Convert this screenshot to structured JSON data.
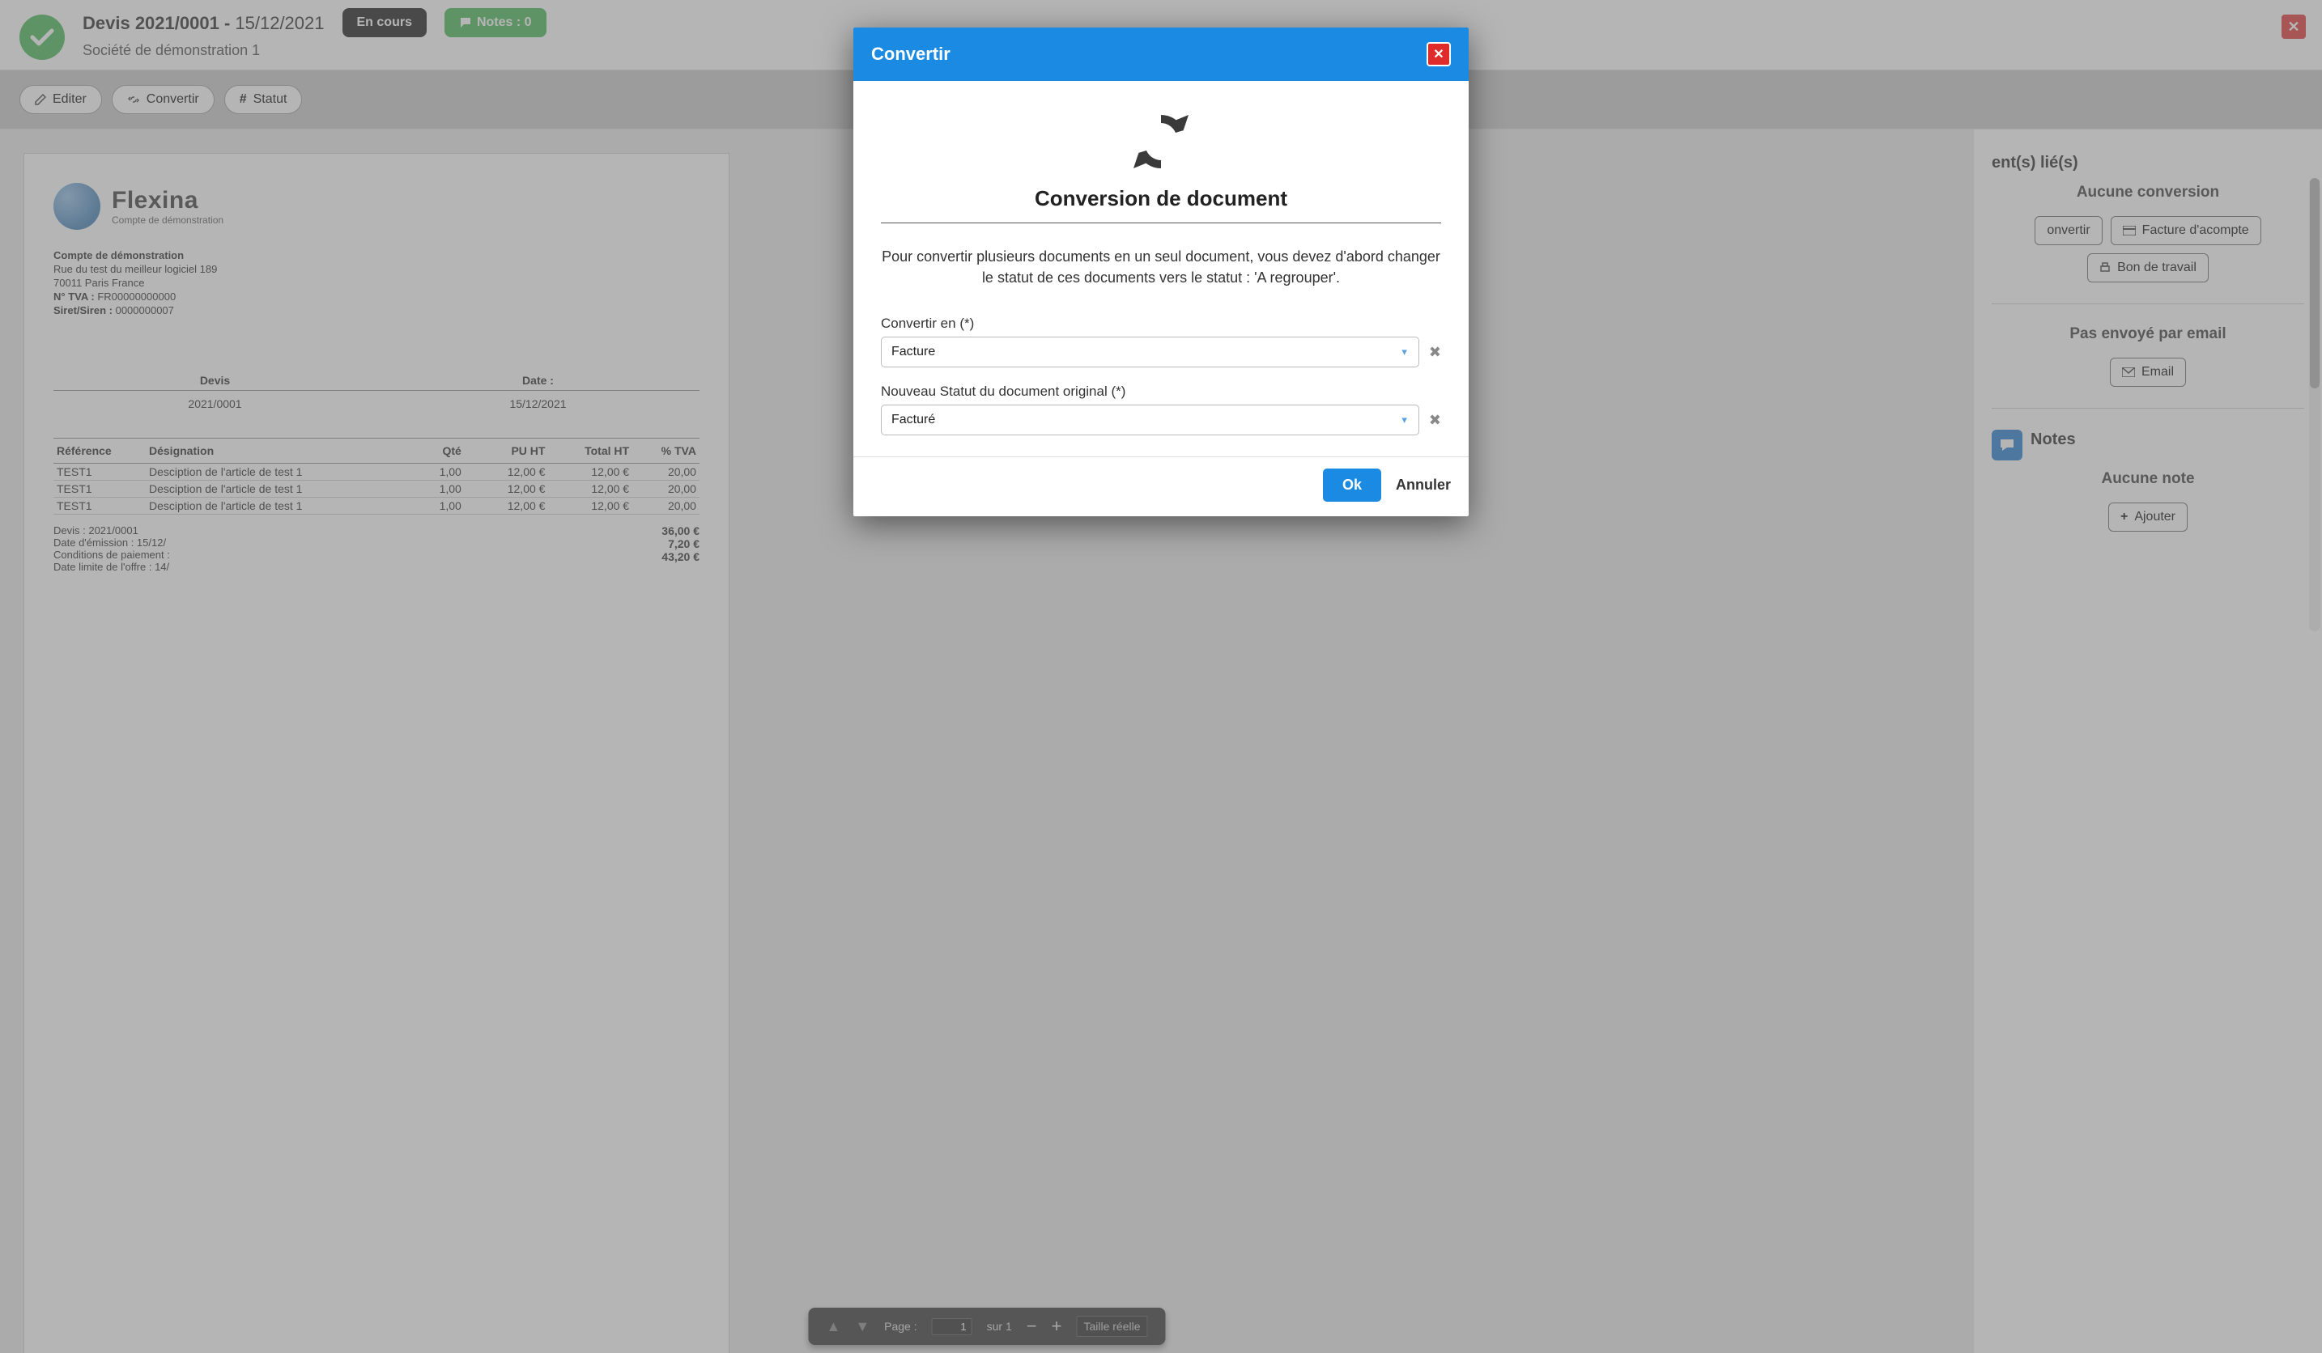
{
  "header": {
    "doc_title": "Devis 2021/0001",
    "date": "15/12/2021",
    "company": "Société de démonstration 1",
    "status_badge": "En cours",
    "notes_badge": "Notes : 0"
  },
  "toolbar": {
    "edit": "Editer",
    "convert": "Convertir",
    "status": "Statut"
  },
  "paper": {
    "brand": "Flexina",
    "brand_sub": "Compte de démonstration",
    "company_name": "Compte de démonstration",
    "address1": "Rue du test du meilleur logiciel 189",
    "address2": "70011 Paris France",
    "tva_label": "N° TVA :",
    "tva": "FR00000000000",
    "siret_label": "Siret/Siren :",
    "siret": "0000000007",
    "doc_col": "Devis",
    "date_col": "Date :",
    "doc_no": "2021/0001",
    "doc_date": "15/12/2021",
    "cols": {
      "ref": "Référence",
      "des": "Désignation",
      "qte": "Qté",
      "pu": "PU HT",
      "tot": "Total HT",
      "tva": "% TVA"
    },
    "rows": [
      {
        "ref": "TEST1",
        "des": "Desciption de l'article de test 1",
        "qte": "1,00",
        "pu": "12,00 €",
        "tot": "12,00 €",
        "tva": "20,00"
      },
      {
        "ref": "TEST1",
        "des": "Desciption de l'article de test 1",
        "qte": "1,00",
        "pu": "12,00 €",
        "tot": "12,00 €",
        "tva": "20,00"
      },
      {
        "ref": "TEST1",
        "des": "Desciption de l'article de test 1",
        "qte": "1,00",
        "pu": "12,00 €",
        "tot": "12,00 €",
        "tva": "20,00"
      }
    ],
    "footer_left": [
      "Devis : 2021/0001",
      "Date d'émission : 15/12/",
      "Conditions de paiement :",
      "Date limite de l'offre : 14/"
    ],
    "totals": [
      "36,00 €",
      "7,20 €",
      "43,20 €"
    ]
  },
  "viewer": {
    "page_label": "Page :",
    "page_no": "1",
    "page_of": "sur 1",
    "zoom": "Taille réelle"
  },
  "side": {
    "linked_title": "ent(s) lié(s)",
    "no_conv": "Aucune conversion",
    "convert_btn": "onvertir",
    "invoice_btn": "Facture d'acompte",
    "work_btn": "Bon de travail",
    "not_sent": "Pas envoyé par email",
    "email_btn": "Email",
    "notes_title": "Notes",
    "no_note": "Aucune note",
    "add_btn": "Ajouter"
  },
  "modal": {
    "header": "Convertir",
    "title": "Conversion de document",
    "desc": "Pour convertir plusieurs documents en un seul document, vous devez d'abord changer le statut de ces documents vers le statut : 'A regrouper'.",
    "field1_label": "Convertir en (*)",
    "field1_value": "Facture",
    "field2_label": "Nouveau Statut du document original (*)",
    "field2_value": "Facturé",
    "ok": "Ok",
    "cancel": "Annuler"
  }
}
